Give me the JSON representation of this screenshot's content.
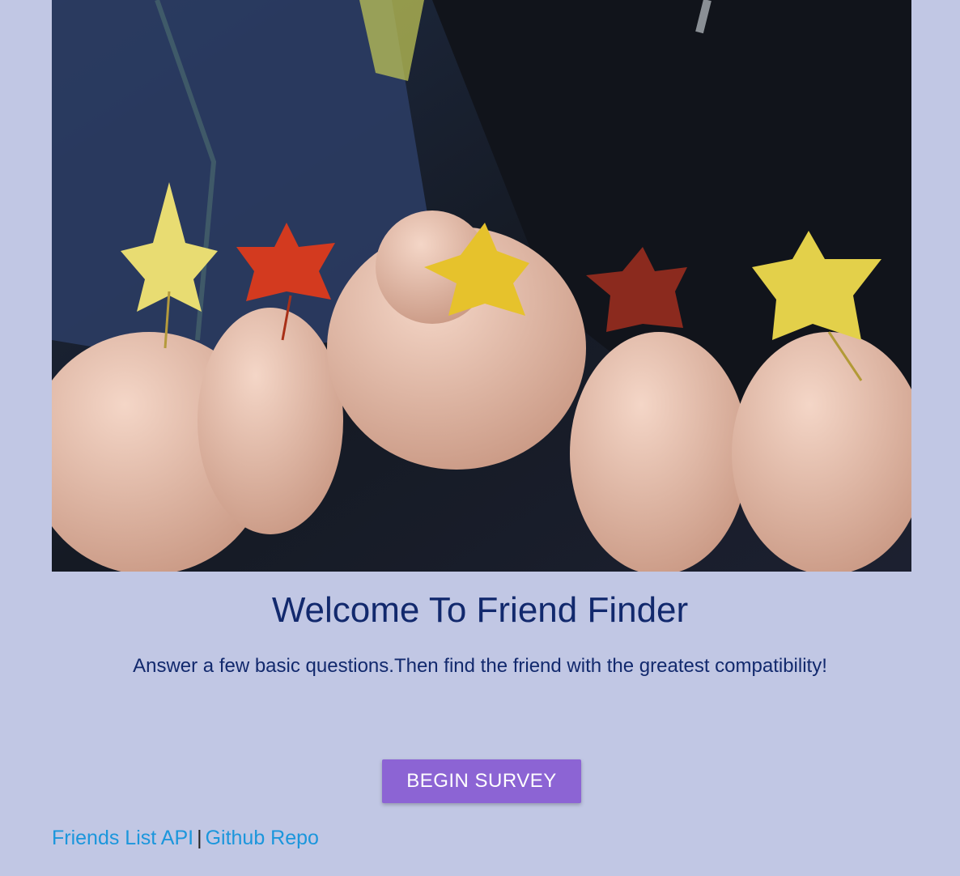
{
  "hero": {
    "image_description_icon": "autumn-leaves-hands-photo"
  },
  "welcome": {
    "title": "Welcome To Friend Finder",
    "subtitle": "Answer a few basic questions.Then find the friend with the greatest compatibility!"
  },
  "actions": {
    "begin_survey_label": "BEGIN SURVEY"
  },
  "footer": {
    "friends_api_label": "Friends List API",
    "separator": "|",
    "github_label": "Github Repo"
  },
  "colors": {
    "background": "#c1c7e4",
    "title": "#12296d",
    "button": "#8c64d4",
    "link": "#1b96dc"
  }
}
